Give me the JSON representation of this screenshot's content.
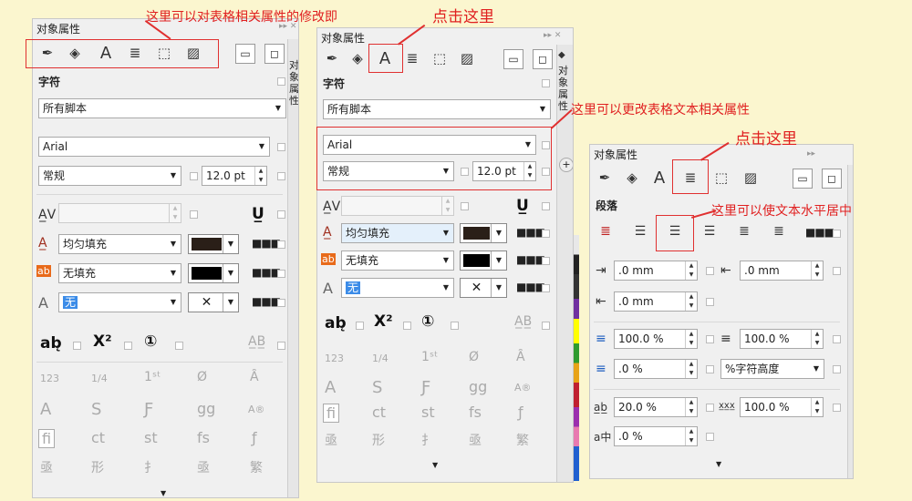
{
  "annotations": {
    "a1": "这里可以对表格相关属性的修改即",
    "a2": "点击这里",
    "a3": "这里可以更改表格文本相关属性",
    "a4": "点击这里",
    "a5": "这里可以使文本水平居中"
  },
  "panel": {
    "title": "对象属性",
    "side_tab": "对象属性",
    "char_section": "字符",
    "para_section": "段落",
    "script": "所有脚本",
    "font": "Arial",
    "style": "常规",
    "size": "12.0 pt",
    "fill1": "均匀填充",
    "fill2": "无填充",
    "outline": "无",
    "char_A": "A"
  },
  "para": {
    "indent_first": ".0 mm",
    "indent_left": ".0 mm",
    "indent_right": ".0 mm",
    "spacing_before": "100.0 %",
    "spacing_after": "100.0 %",
    "line_spacing": ".0 %",
    "line_unit": "%字符高度",
    "char_spacing": "20.0 %",
    "word_spacing": "100.0 %",
    "lang_spacing": ".0 %"
  },
  "colors": {
    "accent_red": "#e02020",
    "selection": "#3c8ce8"
  }
}
